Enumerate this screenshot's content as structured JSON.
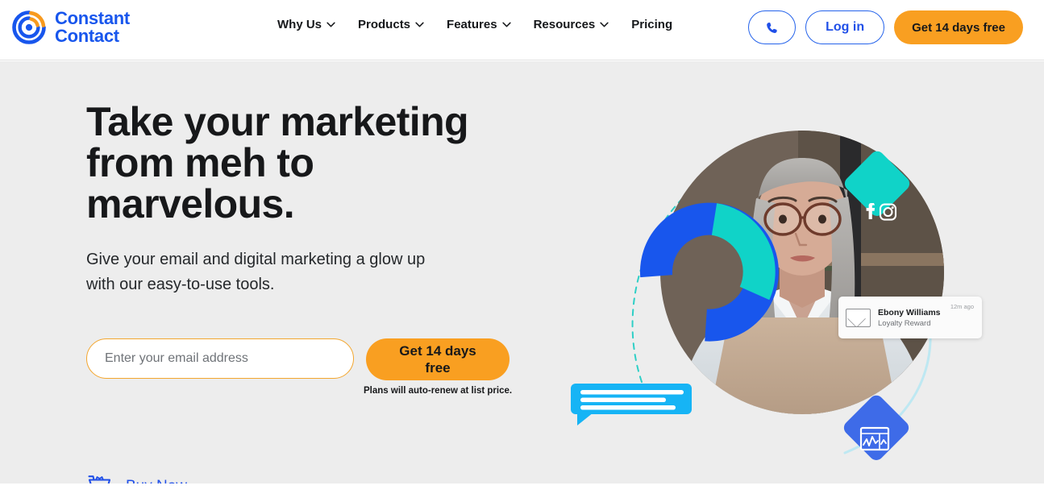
{
  "brand": {
    "name_line1": "Constant",
    "name_line2": "Contact",
    "logo_icon": "constant-contact-circle-logo",
    "blue": "#1856ED",
    "orange": "#F99F21",
    "teal": "#10D3C8",
    "cyan": "#16B4F5"
  },
  "header": {
    "nav": [
      {
        "label": "Why Us",
        "has_dropdown": true
      },
      {
        "label": "Products",
        "has_dropdown": true
      },
      {
        "label": "Features",
        "has_dropdown": true
      },
      {
        "label": "Resources",
        "has_dropdown": true
      },
      {
        "label": "Pricing",
        "has_dropdown": false
      }
    ],
    "phone_icon": "phone-icon",
    "login_label": "Log in",
    "trial_label": "Get 14 days free"
  },
  "hero": {
    "title_line1": "Take your marketing",
    "title_line2": "from meh to",
    "title_line3": "marvelous.",
    "sub_line1": "Give your email and digital marketing a glow up",
    "sub_line2": "with our easy-to-use tools.",
    "email_placeholder": "Enter your email address",
    "email_value": "",
    "cta_line1": "Get 14 days",
    "cta_line2": "free",
    "cta_note": "Plans will auto-renew at list price.",
    "buy_icon": "shopping-cart-icon",
    "buy_label": "Buy Now",
    "background": "#ededed"
  },
  "art": {
    "donut": {
      "icon": "donut-chart",
      "segment_blue_pct": 70,
      "segment_teal_pct": 28,
      "blue": "#1856ED",
      "teal": "#10D3C8"
    },
    "social_badge": {
      "icon": "social-diamond",
      "color": "#10D3C8",
      "icons": [
        "facebook-icon",
        "instagram-icon"
      ]
    },
    "chat_bubble": {
      "icon": "chat-bubble",
      "color": "#16B4F5",
      "lines": 3
    },
    "analytics_badge": {
      "icon": "analytics-diamond",
      "color": "#3E6BE8"
    },
    "notification": {
      "envelope_icon": "envelope-icon",
      "name": "Ebony Williams",
      "description": "Loyalty Reward",
      "time": "12m ago"
    },
    "photo_alt": "woman-with-laptop-photo"
  }
}
